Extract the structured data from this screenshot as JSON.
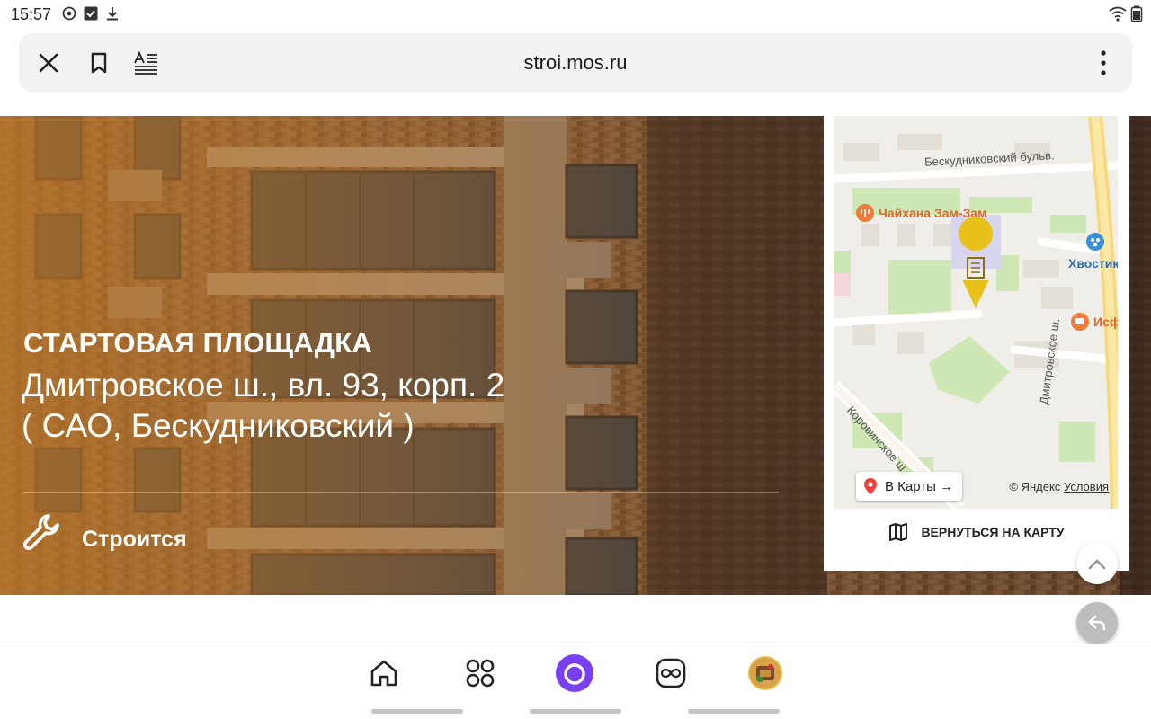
{
  "status_bar": {
    "time": "15:57",
    "icons_left": [
      "sync-icon",
      "checkbox-icon",
      "download-icon"
    ],
    "icons_right": [
      "wifi-icon",
      "battery-icon"
    ]
  },
  "browser": {
    "url": "stroi.mos.ru",
    "buttons": [
      "close-icon",
      "bookmark-icon",
      "reader-mode-icon",
      "more-menu-icon"
    ]
  },
  "hero": {
    "title": "СТАРТОВАЯ ПЛОЩАДКА",
    "address_line1": "Дмитровское ш., вл. 93, корп. 2",
    "address_line2": "( САО, Бескудниковский )",
    "status": "Строится"
  },
  "map": {
    "street_top": "Бескудниковский бульв.",
    "poi_cafe": "Чайхана Зам-Зам",
    "poi_pet": "Хвостик",
    "poi_isf": "Исфи",
    "street_right": "Дмитровское ш.",
    "street_left": "Коровинское ш.",
    "open_in_maps": "В Карты →",
    "copyright": "© Яндекс",
    "terms": "Условия",
    "back_to_map": "ВЕРНУТЬСЯ НА КАРТУ"
  },
  "colors": {
    "accent_purple": "#7b3ff2",
    "map_pin": "#e8c21a",
    "poi_orange": "#f07a3a",
    "poi_blue": "#3a8fd8"
  },
  "bottom_nav": {
    "items": [
      "home-icon",
      "apps-grid-icon",
      "alice-assistant-icon",
      "infinity-icon",
      "profile-avatar"
    ]
  }
}
